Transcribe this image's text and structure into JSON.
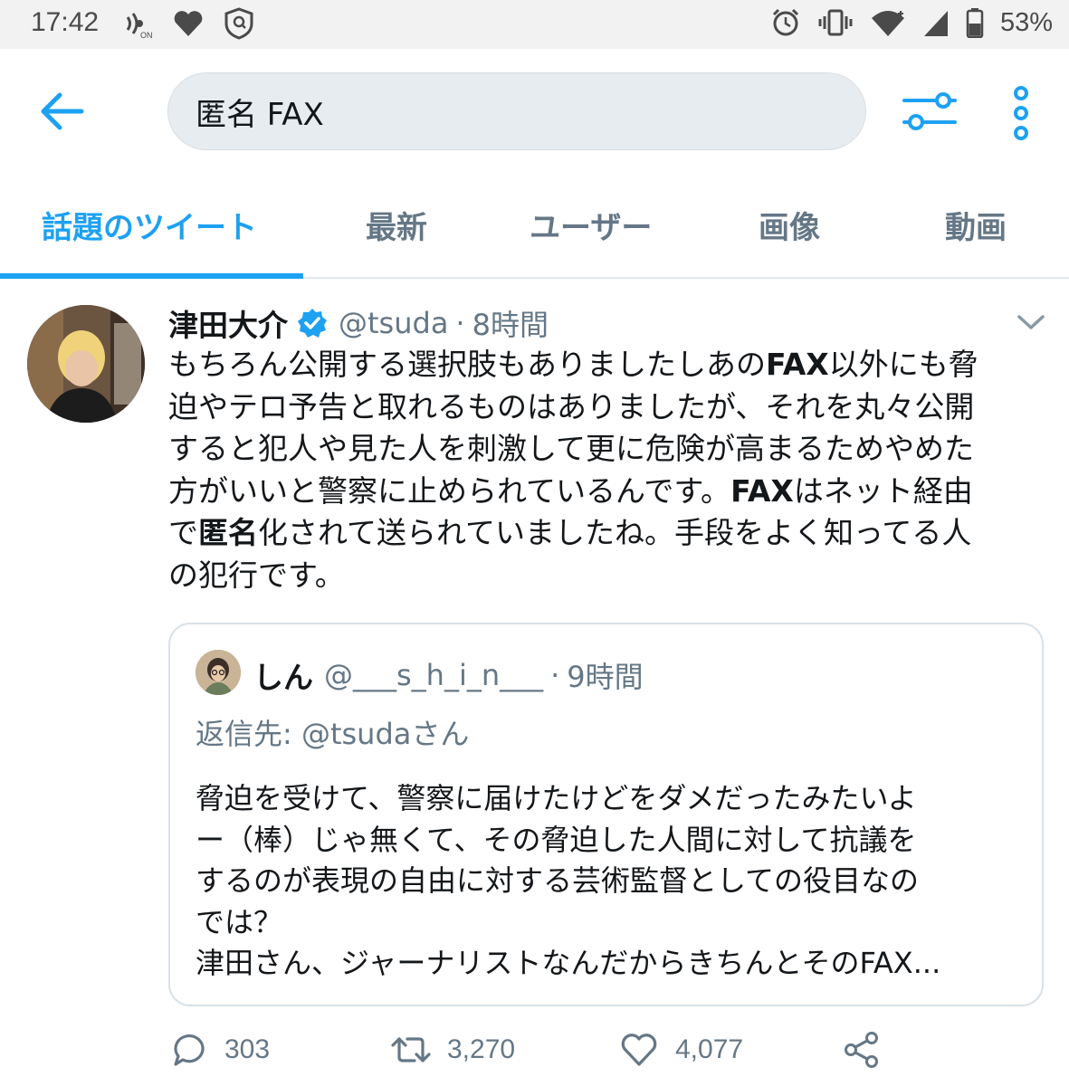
{
  "status_bar": {
    "time": "17:42",
    "battery": "53%",
    "left_icons": [
      "nfc-on-icon",
      "heart-icon",
      "vpn-shield-icon"
    ],
    "right_icons": [
      "alarm-icon",
      "vibrate-icon",
      "wifi-icon",
      "signal-icon",
      "battery-icon"
    ]
  },
  "app_bar": {
    "search_query": "匿名 FAX",
    "back_icon": "arrow-left-icon",
    "filter_icon": "sliders-icon",
    "more_icon": "more-vertical-icon"
  },
  "tabs": [
    {
      "label": "話題のツイート",
      "active": true
    },
    {
      "label": "最新",
      "active": false
    },
    {
      "label": "ユーザー",
      "active": false
    },
    {
      "label": "画像",
      "active": false
    },
    {
      "label": "動画",
      "active": false
    }
  ],
  "tweet": {
    "author_name": "津田大介",
    "handle": "@tsuda",
    "separator": "·",
    "time": "8時間",
    "lines": [
      [
        "もちろん公開する選択肢もありましたしあの",
        "FAX",
        "以外にも脅"
      ],
      [
        "迫やテロ予告と取れるものはありましたが、それを丸々公開"
      ],
      [
        "すると犯人や見た人を刺激して更に危険が高まるためやめた"
      ],
      [
        "方がいいと警察に止められているんです。",
        "FAX",
        "はネット経由"
      ],
      [
        "で",
        "匿名",
        "化されて送られていましたね。手段をよく知ってる人"
      ],
      [
        "の犯行です。"
      ]
    ],
    "quote": {
      "author_name": "しん",
      "handle": "@___s_h_i_n___",
      "separator": "·",
      "time": "9時間",
      "reply_to": "返信先: @tsudaさん",
      "lines": [
        "脅迫を受けて、警察に届けたけどをダメだったみたいよ",
        "ー（棒）じゃ無くて、その脅迫した人間に対して抗議を",
        "するのが表現の自由に対する芸術監督としての役目なの",
        "では？",
        "津田さん、ジャーナリストなんだからきちんとそのFAX..."
      ]
    },
    "actions": {
      "replies": "303",
      "retweets": "3,270",
      "likes": "4,077"
    }
  },
  "colors": {
    "accent": "#1da1f2",
    "muted": "#657786",
    "search_bg": "#e6ecf0"
  }
}
